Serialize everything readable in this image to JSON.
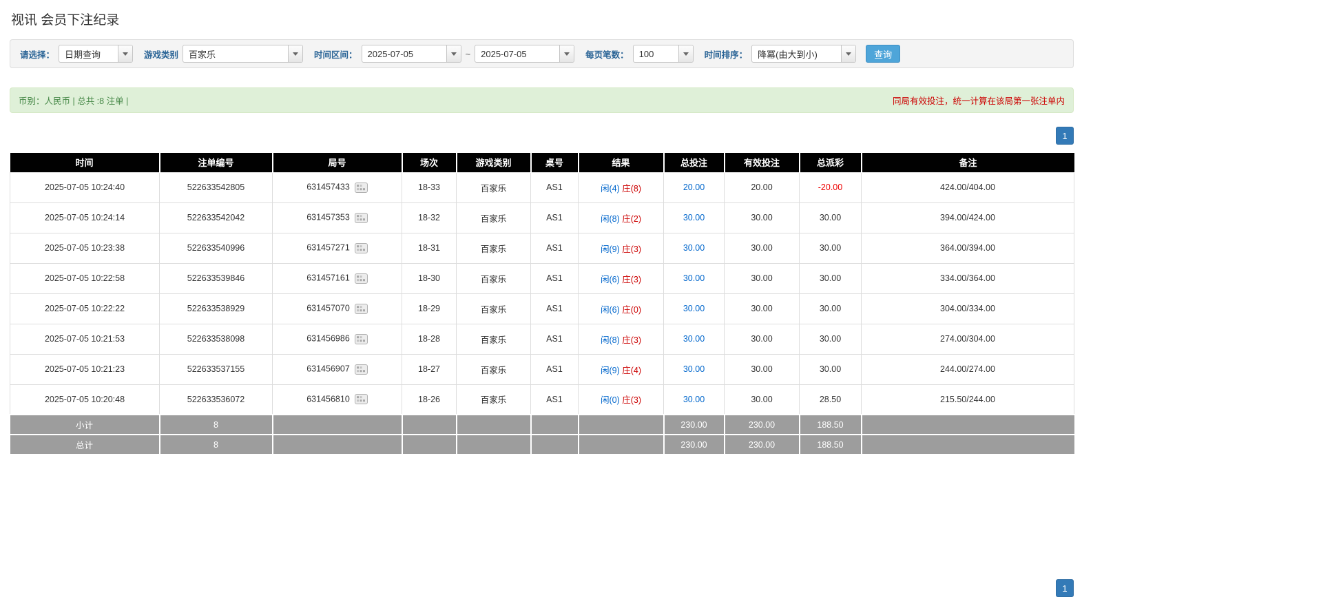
{
  "page": {
    "title": "视讯 会员下注纪录"
  },
  "filters": {
    "select_label": "请选择：",
    "select_value": "日期查询",
    "game_type_label": "游戏类别",
    "game_type_value": "百家乐",
    "time_range_label": "时间区间：",
    "date_from": "2025-07-05",
    "range_separator": "~",
    "date_to": "2025-07-05",
    "page_size_label": "每页笔数：",
    "page_size_value": "100",
    "sort_label": "时间排序：",
    "sort_value": "降冪(由大到小)",
    "search_button_label": "查询"
  },
  "summary_bar": {
    "left_text": "币别：人民币 | 总共 :8 注单 |",
    "right_text": "同局有效投注，统一计算在该局第一张注单内"
  },
  "pagination": {
    "current_page": "1"
  },
  "icons": {
    "dropdown_arrow": "▾",
    "roadmap_button": "▦"
  },
  "colors": {
    "header_bg": "#010101",
    "footer_bg": "#9d9d9d",
    "link_blue": "#0066cc",
    "player_blue": "#0066cc",
    "banker_red": "#cc0000",
    "negative_red": "#ee0000",
    "query_button_blue": "#4ea5d9",
    "pager_blue": "#337ab7",
    "alert_green_bg": "#dff0d8"
  },
  "table": {
    "headers": [
      "时间",
      "注单编号",
      "局号",
      "场次",
      "游戏类别",
      "桌号",
      "结果",
      "总投注",
      "有效投注",
      "总派彩",
      "备注"
    ],
    "rows": [
      {
        "time": "2025-07-05 10:24:40",
        "bet_no": "522633542805",
        "round_no": "631457433",
        "session": "18-33",
        "game_type": "百家乐",
        "table_no": "AS1",
        "result_player": "闲(4)",
        "result_banker": "庄(8)",
        "total_bet": "20.00",
        "valid_bet": "20.00",
        "payout": "-20.00",
        "remark": "424.00/404.00"
      },
      {
        "time": "2025-07-05 10:24:14",
        "bet_no": "522633542042",
        "round_no": "631457353",
        "session": "18-32",
        "game_type": "百家乐",
        "table_no": "AS1",
        "result_player": "闲(8)",
        "result_banker": "庄(2)",
        "total_bet": "30.00",
        "valid_bet": "30.00",
        "payout": "30.00",
        "remark": "394.00/424.00"
      },
      {
        "time": "2025-07-05 10:23:38",
        "bet_no": "522633540996",
        "round_no": "631457271",
        "session": "18-31",
        "game_type": "百家乐",
        "table_no": "AS1",
        "result_player": "闲(9)",
        "result_banker": "庄(3)",
        "total_bet": "30.00",
        "valid_bet": "30.00",
        "payout": "30.00",
        "remark": "364.00/394.00"
      },
      {
        "time": "2025-07-05 10:22:58",
        "bet_no": "522633539846",
        "round_no": "631457161",
        "session": "18-30",
        "game_type": "百家乐",
        "table_no": "AS1",
        "result_player": "闲(6)",
        "result_banker": "庄(3)",
        "total_bet": "30.00",
        "valid_bet": "30.00",
        "payout": "30.00",
        "remark": "334.00/364.00"
      },
      {
        "time": "2025-07-05 10:22:22",
        "bet_no": "522633538929",
        "round_no": "631457070",
        "session": "18-29",
        "game_type": "百家乐",
        "table_no": "AS1",
        "result_player": "闲(6)",
        "result_banker": "庄(0)",
        "total_bet": "30.00",
        "valid_bet": "30.00",
        "payout": "30.00",
        "remark": "304.00/334.00"
      },
      {
        "time": "2025-07-05 10:21:53",
        "bet_no": "522633538098",
        "round_no": "631456986",
        "session": "18-28",
        "game_type": "百家乐",
        "table_no": "AS1",
        "result_player": "闲(8)",
        "result_banker": "庄(3)",
        "total_bet": "30.00",
        "valid_bet": "30.00",
        "payout": "30.00",
        "remark": "274.00/304.00"
      },
      {
        "time": "2025-07-05 10:21:23",
        "bet_no": "522633537155",
        "round_no": "631456907",
        "session": "18-27",
        "game_type": "百家乐",
        "table_no": "AS1",
        "result_player": "闲(9)",
        "result_banker": "庄(4)",
        "total_bet": "30.00",
        "valid_bet": "30.00",
        "payout": "30.00",
        "remark": "244.00/274.00"
      },
      {
        "time": "2025-07-05 10:20:48",
        "bet_no": "522633536072",
        "round_no": "631456810",
        "session": "18-26",
        "game_type": "百家乐",
        "table_no": "AS1",
        "result_player": "闲(0)",
        "result_banker": "庄(3)",
        "total_bet": "30.00",
        "valid_bet": "30.00",
        "payout": "28.50",
        "remark": "215.50/244.00"
      }
    ],
    "subtotal": {
      "label": "小计",
      "count": "8",
      "total_bet": "230.00",
      "valid_bet": "230.00",
      "payout": "188.50"
    },
    "total": {
      "label": "总计",
      "count": "8",
      "total_bet": "230.00",
      "valid_bet": "230.00",
      "payout": "188.50"
    }
  }
}
